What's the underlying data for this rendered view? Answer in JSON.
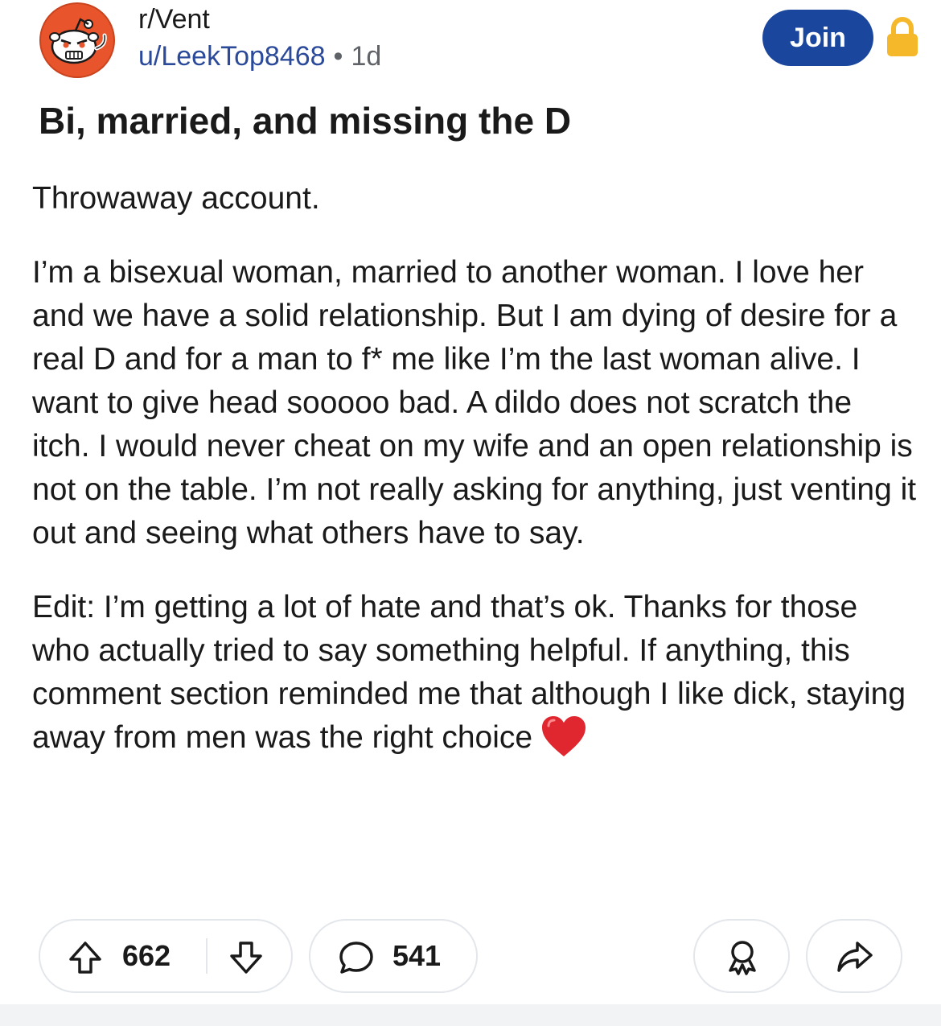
{
  "header": {
    "subreddit": "r/Vent",
    "username": "u/LeekTop8468",
    "separator": "•",
    "age": "1d",
    "join_label": "Join",
    "avatar_icon": "angry-snoo-avatar-icon",
    "lock_icon": "lock-icon"
  },
  "post": {
    "title": "Bi, married, and missing the D",
    "paragraphs": [
      "Throwaway account.",
      "I’m a bisexual woman, married to another woman. I love her and we have a solid relationship. But I am dying of desire for a real D and for a man to f* me like I’m the last woman alive. I want to give head sooooo bad. A dildo does not scratch the itch. I would never cheat on my wife and an open relationship is not on the table. I’m not really asking for anything, just venting it out and seeing what others have to say.",
      "Edit: I’m getting a lot of hate and that’s ok. Thanks for those who actually tried to say something helpful. If anything, this comment section reminded me that although I like dick, staying away from men was the right choice"
    ],
    "trailing_emoji": "red-heart-icon"
  },
  "actions": {
    "votes": "662",
    "comments": "541",
    "icons": [
      "upvote-icon",
      "downvote-icon",
      "comment-icon",
      "award-icon",
      "share-icon"
    ]
  },
  "colors": {
    "join_bg": "#1b469d",
    "user_link": "#2b4a9a",
    "avatar_orange": "#e8542b",
    "lock_yellow": "#f5b82a",
    "heart_red": "#e0262f"
  }
}
